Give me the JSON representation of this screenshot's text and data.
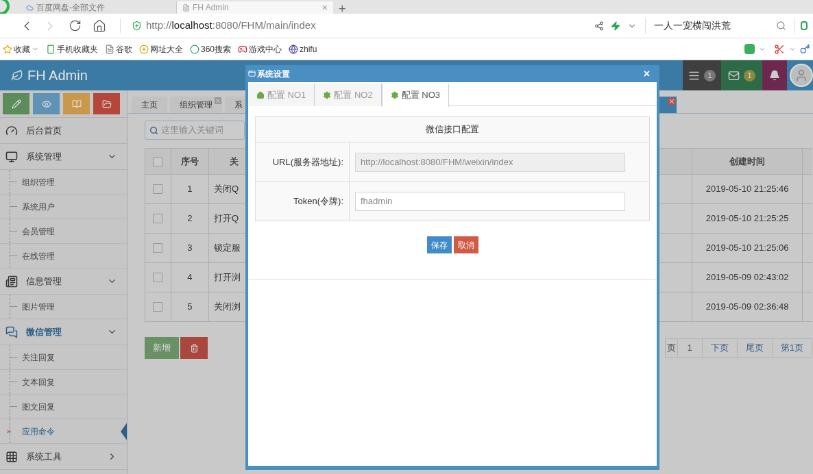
{
  "browser": {
    "tabs": [
      {
        "title": "百度网盘-全部文件",
        "selected": false
      },
      {
        "title": "FH Admin",
        "selected": true,
        "close": "×"
      }
    ],
    "new_tab": "+",
    "url": {
      "scheme": "http://",
      "host": "localhost",
      "rest": ":8080/FHM/main/index"
    },
    "search_text": "一人一宠横闯洪荒",
    "bookmarks": [
      "收藏",
      "手机收藏夹",
      "谷歌",
      "网址大全",
      "360搜索",
      "游戏中心",
      "zhifu"
    ]
  },
  "app": {
    "brand": "FH Admin",
    "header_items": [
      {
        "kind": "tasks",
        "count": "1"
      },
      {
        "kind": "mail",
        "count": "1"
      },
      {
        "kind": "bell"
      },
      {
        "kind": "avatar"
      }
    ],
    "shortcuts": [
      {
        "color": "#5b8c5a"
      },
      {
        "color": "#5f93b5"
      },
      {
        "color": "#c9984a"
      },
      {
        "color": "#b5473a"
      }
    ],
    "menu": [
      {
        "label": "后台首页",
        "selected": false
      },
      {
        "label": "系统管理",
        "selected": false,
        "expanded": true,
        "children": [
          {
            "label": "组织管理",
            "selected": false
          },
          {
            "label": "系统用户",
            "selected": false
          },
          {
            "label": "会员管理",
            "selected": false
          },
          {
            "label": "在线管理",
            "selected": false
          }
        ]
      },
      {
        "label": "信息管理",
        "selected": false,
        "expanded": true,
        "children": [
          {
            "label": "图片管理",
            "selected": false
          }
        ]
      },
      {
        "label": "微信管理",
        "selected": true,
        "expanded": true,
        "children": [
          {
            "label": "关注回复",
            "selected": false
          },
          {
            "label": "文本回复",
            "selected": false
          },
          {
            "label": "图文回复",
            "selected": false
          },
          {
            "label": "应用命令",
            "selected": true,
            "marker": "»"
          }
        ]
      },
      {
        "label": "系统工具",
        "selected": false,
        "expanded": false
      }
    ],
    "content_tabs": [
      {
        "label": "主页",
        "closable": false
      },
      {
        "label": "组织管理",
        "closable": true
      },
      {
        "label": "系",
        "closable": false
      }
    ],
    "search": {
      "placeholder": "这里输入关键词"
    },
    "table": {
      "columns": [
        "序号",
        "关",
        "创建时间"
      ],
      "all_checked": false,
      "rows": [
        {
          "checked": false,
          "number": "1",
          "column_3": "关闭Q",
          "created": "2019-05-10 21:25:46"
        },
        {
          "checked": false,
          "number": "2",
          "column_3": "打开Q",
          "created": "2019-05-10 21:25:25"
        },
        {
          "checked": false,
          "number": "3",
          "column_3": "锁定服",
          "created": "2019-05-10 21:25:06"
        },
        {
          "checked": false,
          "number": "4",
          "column_3": "打开浏",
          "created": "2019-05-09 02:43:02"
        },
        {
          "checked": false,
          "number": "5",
          "column_3": "关闭浏",
          "created": "2019-05-09 02:36:48"
        }
      ]
    },
    "add_button": "新增",
    "pagination": [
      "页",
      "1",
      "下页",
      "尾页",
      "第1页"
    ]
  },
  "dialog": {
    "title": "系统设置",
    "close": "×",
    "tabs": [
      {
        "label": "配置 NO1",
        "selected": false
      },
      {
        "label": "配置 NO2",
        "selected": false
      },
      {
        "label": "配置 NO3",
        "selected": true
      }
    ],
    "section_title": "微信接口配置",
    "fields": [
      {
        "label": "URL(服务器地址):",
        "value": "http://localhost:8080/FHM/weixin/index",
        "readonly": true
      },
      {
        "label": "Token(令牌):",
        "value": "fhadmin",
        "readonly": false
      }
    ],
    "buttons": [
      {
        "label": "保存",
        "kind": "primary"
      },
      {
        "label": "取消",
        "kind": "danger"
      }
    ]
  }
}
